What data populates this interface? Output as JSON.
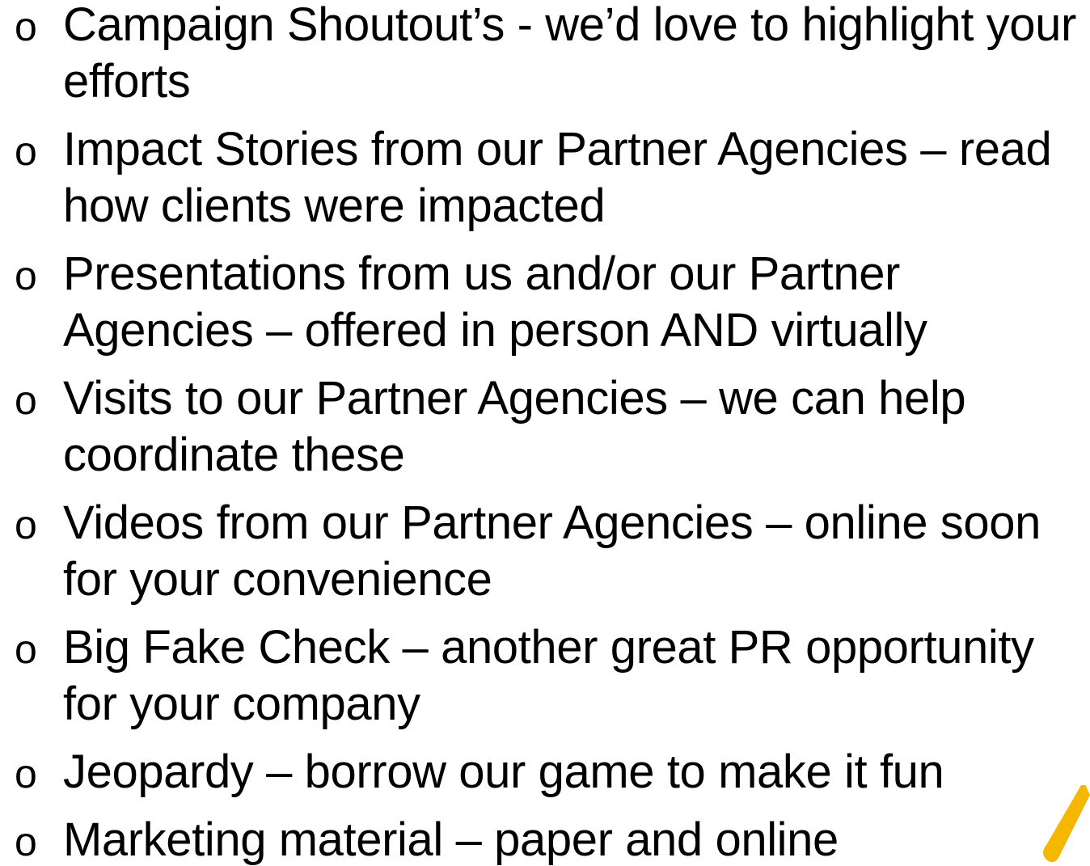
{
  "slide": {
    "bullet_marker": "o",
    "items": [
      {
        "text": "Campaign Shoutout’s - we’d love to highlight your efforts"
      },
      {
        "text": "Impact Stories from our Partner Agencies – read how clients were impacted"
      },
      {
        "text": "Presentations from us and/or our Partner Agencies – offered in person AND virtually"
      },
      {
        "text": "Visits to our Partner Agencies – we can help coordinate these"
      },
      {
        "text": "Videos from our Partner Agencies – online soon for your convenience"
      },
      {
        "text": "Big Fake Check – another great PR opportunity for your company"
      },
      {
        "text": "Jeopardy – borrow our game to make it fun"
      },
      {
        "text": "Marketing material – paper and online"
      }
    ]
  },
  "colors": {
    "background": "#ffffff",
    "text": "#000000",
    "accent": "#F5B700"
  }
}
